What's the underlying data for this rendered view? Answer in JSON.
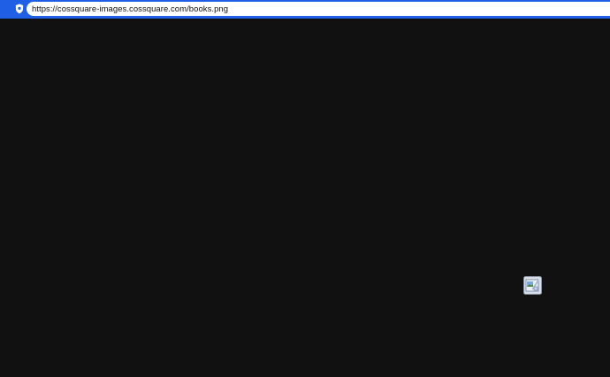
{
  "address_bar": {
    "url": "https://cossquare-images.cossquare.com/books.png",
    "security_icon": "shield-icon",
    "accent_color": "#1e5fe6"
  },
  "page": {
    "background_color": "#111111",
    "image": {
      "state": "broken",
      "icon": "broken-image-icon"
    }
  }
}
